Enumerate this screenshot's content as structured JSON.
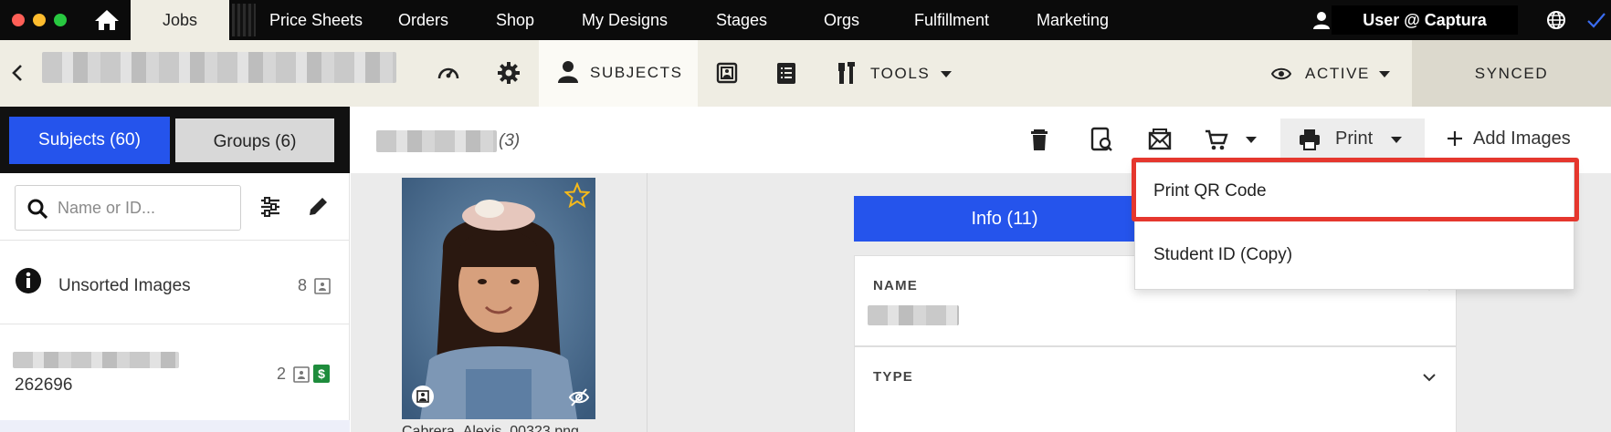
{
  "window": {
    "traffic_lights": [
      "#ff5f57",
      "#febc2e",
      "#28c840"
    ]
  },
  "topnav": {
    "tabs": [
      {
        "label": "Jobs",
        "active": true
      },
      {
        "label": "Price Sheets"
      },
      {
        "label": "Orders"
      },
      {
        "label": "Shop"
      },
      {
        "label": "My Designs"
      },
      {
        "label": "Stages"
      },
      {
        "label": "Orgs"
      },
      {
        "label": "Fulfillment"
      },
      {
        "label": "Marketing"
      }
    ],
    "user": "User @ Captura"
  },
  "subbar": {
    "subjects_label": "SUBJECTS",
    "tools_label": "TOOLS",
    "active_label": "ACTIVE",
    "synced_label": "SYNCED"
  },
  "left": {
    "subjects_tab": "Subjects (60)",
    "groups_tab": "Groups (6)",
    "search_placeholder": "Name or ID...",
    "unsorted_label": "Unsorted Images",
    "unsorted_count": "8",
    "row_id": "262696",
    "row_count": "2"
  },
  "content": {
    "subject_count": "(3)",
    "print_label": "Print",
    "add_images_label": "Add Images",
    "photo_filename": "Cabrera_Alexis_00323.png",
    "info_tab": "Info (11)",
    "fields": [
      {
        "label": "NAME"
      },
      {
        "label": "TYPE"
      }
    ]
  },
  "print_menu": {
    "items": [
      "Print QR Code",
      "Student ID (Copy)"
    ],
    "highlighted": "Print QR Code"
  },
  "colors": {
    "accent": "#2554ec",
    "highlight": "#e5372e",
    "money": "#1e8c3c"
  }
}
